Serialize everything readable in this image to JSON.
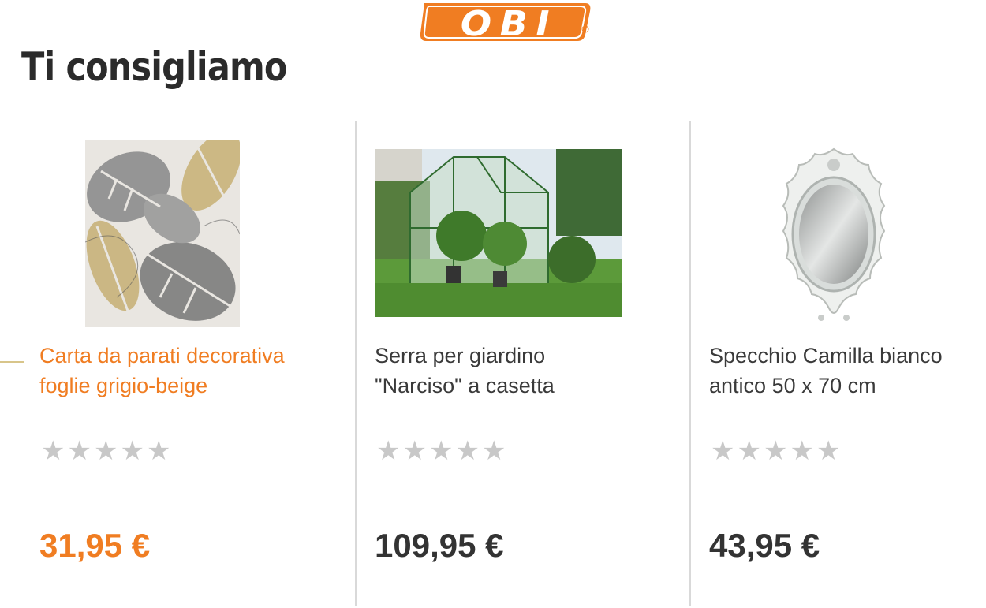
{
  "brand": {
    "logo_text": "OBI",
    "color": "#f07d22"
  },
  "heading": "Ti consigliamo",
  "products": [
    {
      "title_line1": "Carta da parati decorativa",
      "title_line2": "foglie grigio-beige",
      "rating_stars": 0,
      "price": "31,95 €",
      "image": "leaf-wallpaper-image",
      "active": true
    },
    {
      "title_line1": "Serra per giardino",
      "title_line2": "\"Narciso\" a casetta",
      "rating_stars": 0,
      "price": "109,95 €",
      "image": "greenhouse-image",
      "active": false
    },
    {
      "title_line1": "Specchio Camilla bianco",
      "title_line2": "antico 50 x 70 cm",
      "rating_stars": 0,
      "price": "43,95 €",
      "image": "ornate-mirror-image",
      "active": false
    }
  ],
  "colors": {
    "accent": "#f07d22",
    "text": "#333333",
    "star_empty": "#c8c8c8",
    "divider": "#d9d9d9"
  }
}
